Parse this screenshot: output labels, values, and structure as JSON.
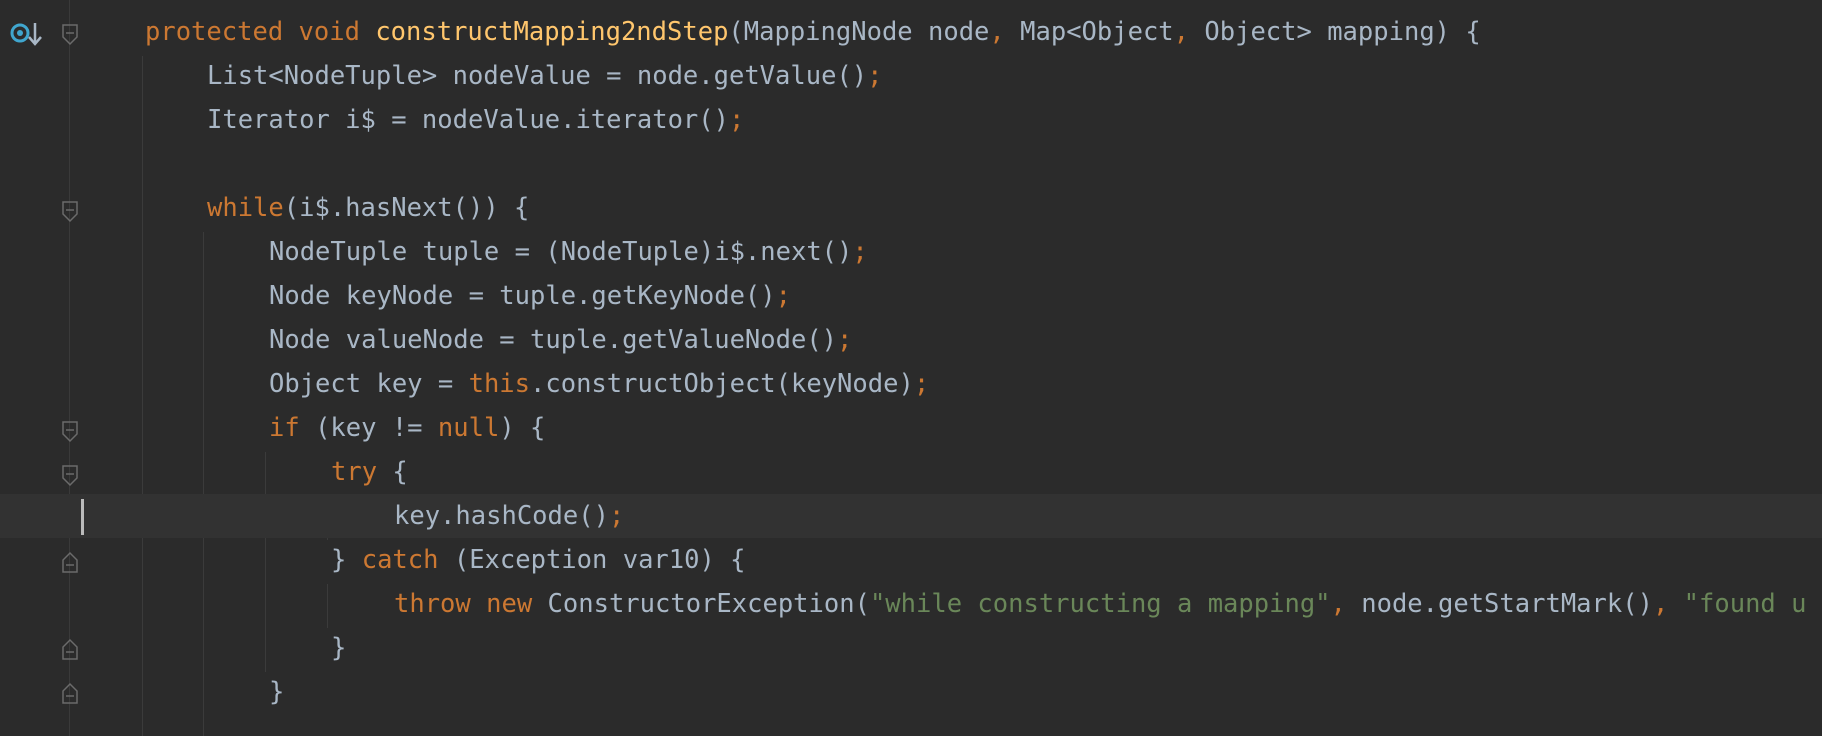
{
  "editor": {
    "language": "java",
    "lines": [
      {
        "tokens": [
          {
            "t": "protected",
            "c": "kw"
          },
          {
            "t": " ",
            "c": "plain"
          },
          {
            "t": "void",
            "c": "kw"
          },
          {
            "t": " ",
            "c": "plain"
          },
          {
            "t": "constructMapping2ndStep",
            "c": "fn"
          },
          {
            "t": "(MappingNode node",
            "c": "plain"
          },
          {
            "t": ",",
            "c": "punct"
          },
          {
            "t": " Map<Object",
            "c": "plain"
          },
          {
            "t": ",",
            "c": "punct"
          },
          {
            "t": " Object> mapping) {",
            "c": "plain"
          }
        ]
      },
      {
        "tokens": [
          {
            "t": "List<NodeTuple> nodeValue = node.getValue()",
            "c": "plain"
          },
          {
            "t": ";",
            "c": "punct"
          }
        ]
      },
      {
        "tokens": [
          {
            "t": "Iterator i$ = nodeValue.iterator()",
            "c": "plain"
          },
          {
            "t": ";",
            "c": "punct"
          }
        ]
      },
      {
        "tokens": []
      },
      {
        "tokens": [
          {
            "t": "while",
            "c": "kw"
          },
          {
            "t": "(i$.hasNext()) {",
            "c": "plain"
          }
        ]
      },
      {
        "tokens": [
          {
            "t": "NodeTuple tuple = (NodeTuple)i$.next()",
            "c": "plain"
          },
          {
            "t": ";",
            "c": "punct"
          }
        ]
      },
      {
        "tokens": [
          {
            "t": "Node keyNode = tuple.getKeyNode()",
            "c": "plain"
          },
          {
            "t": ";",
            "c": "punct"
          }
        ]
      },
      {
        "tokens": [
          {
            "t": "Node valueNode = tuple.getValueNode()",
            "c": "plain"
          },
          {
            "t": ";",
            "c": "punct"
          }
        ]
      },
      {
        "tokens": [
          {
            "t": "Object key = ",
            "c": "plain"
          },
          {
            "t": "this",
            "c": "kw"
          },
          {
            "t": ".constructObject(keyNode)",
            "c": "plain"
          },
          {
            "t": ";",
            "c": "punct"
          }
        ]
      },
      {
        "tokens": [
          {
            "t": "if",
            "c": "kw"
          },
          {
            "t": " (key != ",
            "c": "plain"
          },
          {
            "t": "null",
            "c": "kw"
          },
          {
            "t": ") {",
            "c": "plain"
          }
        ]
      },
      {
        "tokens": [
          {
            "t": "try",
            "c": "kw"
          },
          {
            "t": " {",
            "c": "plain"
          }
        ]
      },
      {
        "tokens": [
          {
            "t": "key.hashCode()",
            "c": "plain"
          },
          {
            "t": ";",
            "c": "punct"
          }
        ]
      },
      {
        "tokens": [
          {
            "t": "} ",
            "c": "plain"
          },
          {
            "t": "catch",
            "c": "kw"
          },
          {
            "t": " (Exception var10) {",
            "c": "plain"
          }
        ]
      },
      {
        "tokens": [
          {
            "t": "throw",
            "c": "kw"
          },
          {
            "t": " ",
            "c": "plain"
          },
          {
            "t": "new",
            "c": "kw"
          },
          {
            "t": " ConstructorException(",
            "c": "plain"
          },
          {
            "t": "\"while constructing a mapping\"",
            "c": "str"
          },
          {
            "t": ",",
            "c": "punct"
          },
          {
            "t": " node.getStartMark()",
            "c": "plain"
          },
          {
            "t": ",",
            "c": "punct"
          },
          {
            "t": " ",
            "c": "plain"
          },
          {
            "t": "\"found u",
            "c": "str"
          }
        ]
      },
      {
        "tokens": [
          {
            "t": "}",
            "c": "plain"
          }
        ]
      },
      {
        "tokens": [
          {
            "t": "}",
            "c": "plain"
          }
        ]
      }
    ],
    "current_line": 11,
    "icons": {
      "override_marker": "implements-method-icon",
      "fold_open": "fold-open-icon",
      "fold_close": "fold-close-icon"
    },
    "colors": {
      "background": "#2b2b2b",
      "current_line": "#323232",
      "keyword": "#cc7832",
      "function": "#ffc66d",
      "string": "#6a8759",
      "text": "#a9b7c6",
      "marker": "#40a6ce"
    }
  }
}
